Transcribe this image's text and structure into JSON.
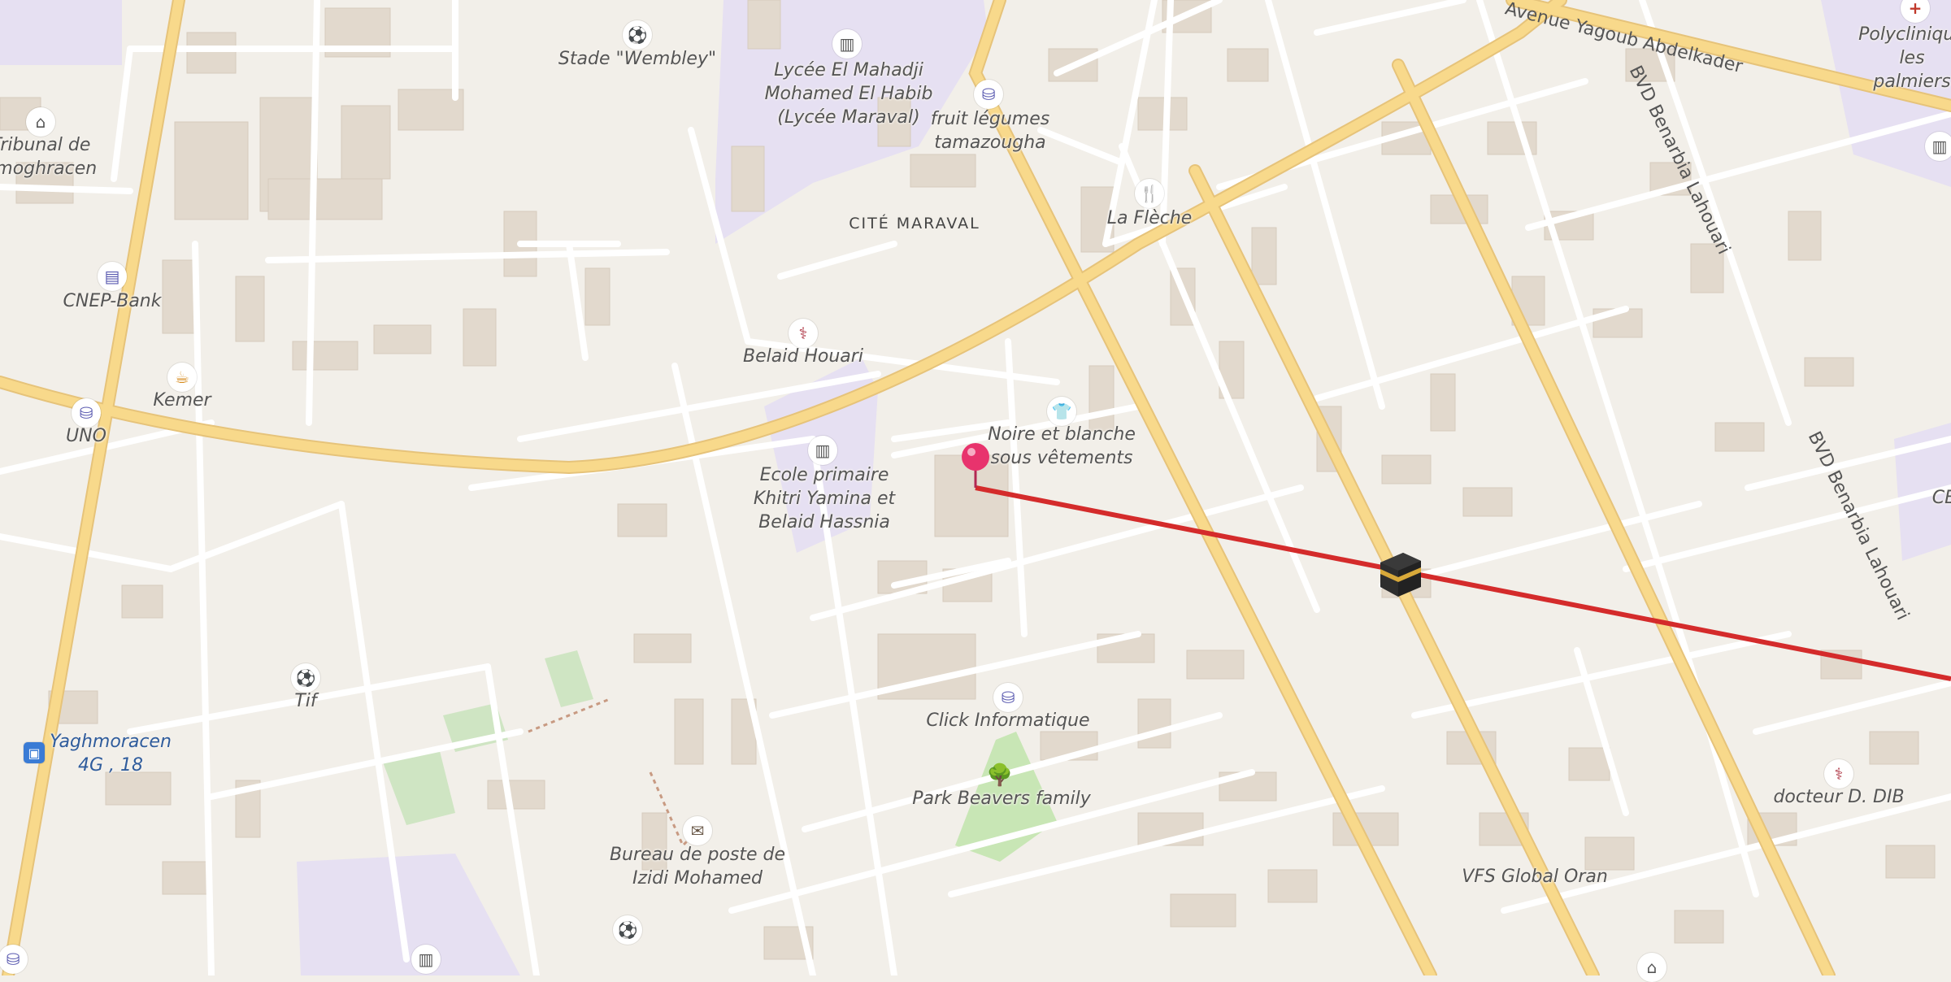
{
  "map": {
    "colors": {
      "background": "#f2efe9",
      "building": "#e2d9cd",
      "road_minor": "#ffffff",
      "road_major": "#f8d98b",
      "school_area": "#e6e0f2",
      "park": "#c8e6b5",
      "route_line": "#d42b2b",
      "pin": "#e8336d"
    },
    "districts": [
      {
        "id": "cite-maraval",
        "label": "CITÉ MARAVAL"
      }
    ],
    "streets": [
      {
        "id": "avenue-yagoub",
        "label": "Avenue Yagoub Abdelkader"
      },
      {
        "id": "bvd-benarbia-1",
        "label": "BVD Benarbia Lahouari"
      },
      {
        "id": "bvd-benarbia-2",
        "label": "BVD Benarbia Lahouari"
      }
    ],
    "pois": [
      {
        "id": "stade-wembley",
        "label": "Stade \"Wembley\"",
        "icon": "sports-icon",
        "color": "#6a9b2e"
      },
      {
        "id": "lycee",
        "label": "Lycée El Mahadji\nMohamed El Habib\n(Lycée Maraval)",
        "icon": "school-icon",
        "color": "#555555"
      },
      {
        "id": "fruit-legumes",
        "label": "fruit légumes\ntamazougha",
        "icon": "shop-icon",
        "color": "#5a5ab0"
      },
      {
        "id": "polyclinique",
        "label": "Polyclinique\nles palmiers",
        "icon": "hospital-icon",
        "color": "#c0392b"
      },
      {
        "id": "tribunal",
        "label": "Tribunal de\namoghracen",
        "icon": "courthouse-icon",
        "color": "#555555"
      },
      {
        "id": "la-fleche",
        "label": "La Flèche",
        "icon": "restaurant-icon",
        "color": "#d68a1a"
      },
      {
        "id": "cnep-bank",
        "label": "CNEP-Bank",
        "icon": "bank-icon",
        "color": "#5a5ab0"
      },
      {
        "id": "belaid-houari",
        "label": "Belaid Houari",
        "icon": "doctor-icon",
        "color": "#b03a48"
      },
      {
        "id": "kemer",
        "label": "Kemer",
        "icon": "cafe-icon",
        "color": "#d68a1a"
      },
      {
        "id": "uno",
        "label": "UNO",
        "icon": "shop-icon",
        "color": "#5a5ab0"
      },
      {
        "id": "noire-blanche",
        "label": "Noire et blanche\nsous vêtements",
        "icon": "clothes-icon",
        "color": "#5a5ab0"
      },
      {
        "id": "ecole-primaire",
        "label": "Ecole primaire\nKhitri Yamina et\nBelaid Hassnia",
        "icon": "school-icon",
        "color": "#555555"
      },
      {
        "id": "tif",
        "label": "Tif",
        "icon": "sports-icon",
        "color": "#6a9b2e"
      },
      {
        "id": "click-informatique",
        "label": "Click Informatique",
        "icon": "shop-icon",
        "color": "#5a5ab0"
      },
      {
        "id": "park-beavers",
        "label": "Park Beavers family",
        "icon": "tree-icon",
        "color": "#4a9a3a"
      },
      {
        "id": "yaghmoracen",
        "label": "Yaghmoracen\n4G , 18",
        "icon": "bus-stop-icon",
        "color": "#3a7bd5"
      },
      {
        "id": "bureau-poste",
        "label": "Bureau de poste de\nIzidi Mohamed",
        "icon": "post-office-icon",
        "color": "#6b5a4a"
      },
      {
        "id": "docteur-dib",
        "label": "docteur D. DIB",
        "icon": "doctor-icon",
        "color": "#b03a48"
      },
      {
        "id": "vfs-global",
        "label": "VFS Global Oran",
        "icon": "",
        "color": "#555555"
      },
      {
        "id": "cb-partial",
        "label": "CB",
        "icon": "",
        "color": "#555555"
      }
    ],
    "markers": [
      {
        "id": "location-pin",
        "icon": "map-pin-icon"
      },
      {
        "id": "kaaba-marker",
        "icon": "kaaba-icon"
      }
    ]
  }
}
